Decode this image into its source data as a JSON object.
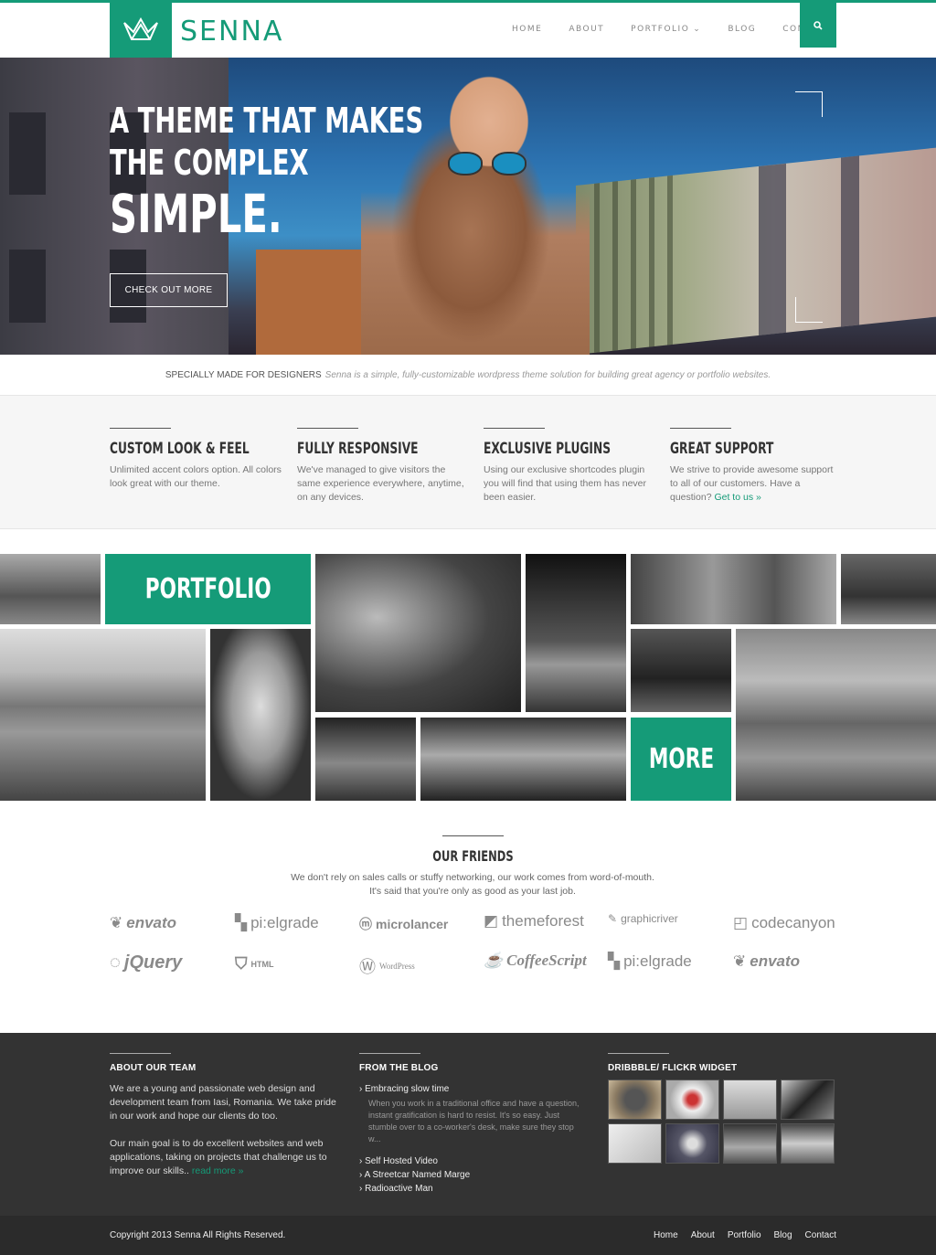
{
  "colors": {
    "accent": "#159b78",
    "footer_bg": "#333333",
    "bottom_bar_bg": "#2b2b2b"
  },
  "header": {
    "logo_icon": "crown-icon",
    "logo_text": "SENNA",
    "nav": [
      "HOME",
      "ABOUT",
      "PORTFOLIO",
      "BLOG",
      "CONTACT"
    ],
    "portfolio_dropdown_icon": "chevron-down-icon",
    "search_icon": "search-icon"
  },
  "hero": {
    "line1": "A THEME THAT MAKES",
    "line2": "THE COMPLEX",
    "line3": "SIMPLE.",
    "button": "CHECK OUT MORE"
  },
  "tagline": {
    "lead": "SPECIALLY MADE FOR DESIGNERS",
    "text": "Senna is a simple, fully-customizable wordpress theme solution for building great agency or portfolio websites."
  },
  "features": [
    {
      "title": "CUSTOM LOOK & FEEL",
      "text": "Unlimited accent colors option. All colors look great with our theme.",
      "link": ""
    },
    {
      "title": "FULLY RESPONSIVE",
      "text": "We've managed to give visitors the same experience everywhere, anytime, on any devices.",
      "link": ""
    },
    {
      "title": "EXCLUSIVE PLUGINS",
      "text": "Using our exclusive shortcodes plugin you will find that using them has never been easier.",
      "link": ""
    },
    {
      "title": "GREAT SUPPORT",
      "text": "We strive to provide awesome support to all of our customers. Have a question?",
      "link": "Get to us »"
    }
  ],
  "portfolio": {
    "title": "PORTFOLIO",
    "more": "MORE"
  },
  "friends": {
    "title": "OUR FRIENDS",
    "line1": "We don't rely on sales calls or stuffy networking, our work comes from word-of-mouth.",
    "line2": "It's said that you're only as good as your last job.",
    "brands_row1": [
      "envato",
      "pi:elgrade",
      "microlancer",
      "themeforest",
      "graphicriver",
      "codecanyon"
    ],
    "brands_row2": [
      "jQuery",
      "HTML",
      "WordPress",
      "CoffeeScript",
      "pi:elgrade",
      "envato"
    ]
  },
  "footer": {
    "about": {
      "title": "ABOUT OUR TEAM",
      "p1": "We are a young and passionate web design and development team from Iasi, Romania. We take pride in our work and hope our clients do too.",
      "p2": "Our main goal is to do excellent websites and web applications, taking on projects that challenge us to improve our skills..",
      "link": "read more »"
    },
    "blog": {
      "title": "FROM THE BLOG",
      "posts": [
        "Embracing slow time",
        "Self Hosted Video",
        "A Streetcar Named Marge",
        "Radioactive Man"
      ],
      "excerpt": "When you work in a traditional office and have a question, instant gratification is hard to resist. It's so easy. Just stumble over to a co-worker's desk, make sure they stop w..."
    },
    "widget": {
      "title": "DRIBBBLE/ FLICKR WIDGET"
    }
  },
  "bottom": {
    "copyright": "Copyright 2013 Senna All Rights Reserved.",
    "nav": [
      "Home",
      "About",
      "Portfolio",
      "Blog",
      "Contact"
    ]
  }
}
